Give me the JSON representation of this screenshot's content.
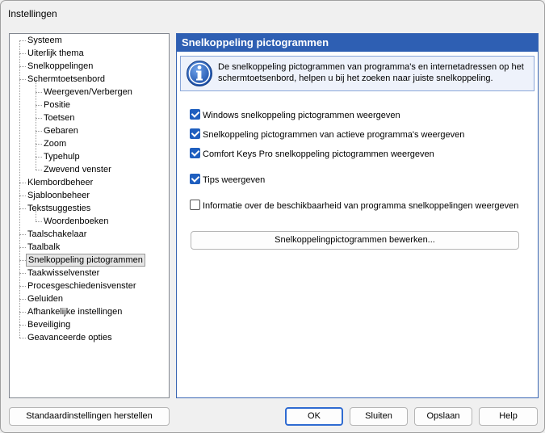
{
  "window": {
    "title": "Instellingen"
  },
  "tree": {
    "items": [
      {
        "label": "Systeem",
        "level": 0
      },
      {
        "label": "Uiterlijk thema",
        "level": 0
      },
      {
        "label": "Snelkoppelingen",
        "level": 0
      },
      {
        "label": "Schermtoetsenbord",
        "level": 0
      },
      {
        "label": "Weergeven/Verbergen",
        "level": 1
      },
      {
        "label": "Positie",
        "level": 1
      },
      {
        "label": "Toetsen",
        "level": 1
      },
      {
        "label": "Gebaren",
        "level": 1
      },
      {
        "label": "Zoom",
        "level": 1
      },
      {
        "label": "Typehulp",
        "level": 1
      },
      {
        "label": "Zwevend venster",
        "level": 1
      },
      {
        "label": "Klembordbeheer",
        "level": 0
      },
      {
        "label": "Sjabloonbeheer",
        "level": 0
      },
      {
        "label": "Tekstsuggesties",
        "level": 0
      },
      {
        "label": "Woordenboeken",
        "level": 1
      },
      {
        "label": "Taalschakelaar",
        "level": 0
      },
      {
        "label": "Taalbalk",
        "level": 0
      },
      {
        "label": "Snelkoppeling pictogrammen",
        "level": 0,
        "selected": true
      },
      {
        "label": "Taakwisselvenster",
        "level": 0
      },
      {
        "label": "Procesgeschiedenisvenster",
        "level": 0
      },
      {
        "label": "Geluiden",
        "level": 0
      },
      {
        "label": "Afhankelijke instellingen",
        "level": 0
      },
      {
        "label": "Beveiliging",
        "level": 0
      },
      {
        "label": "Geavanceerde opties",
        "level": 0
      }
    ]
  },
  "panel": {
    "header": "Snelkoppeling pictogrammen",
    "info_icon": "info-icon",
    "info_text": "De snelkoppeling pictogrammen van programma's en internetadressen op het schermtoetsenbord, helpen u bij het zoeken naar juiste snelkoppeling.",
    "checkboxes": [
      {
        "label": "Windows snelkoppeling pictogrammen weergeven",
        "checked": true
      },
      {
        "label": "Snelkoppeling pictogrammen van actieve programma's weergeven",
        "checked": true
      },
      {
        "label": "Comfort Keys Pro snelkoppeling pictogrammen weergeven",
        "checked": true
      },
      {
        "label": "Tips weergeven",
        "checked": true
      },
      {
        "label": "Informatie over de beschikbaarheid van programma snelkoppelingen weergeven",
        "checked": false
      }
    ],
    "edit_button": "Snelkoppelingpictogrammen bewerken..."
  },
  "footer": {
    "reset": "Standaardinstellingen herstellen",
    "ok": "OK",
    "close": "Sluiten",
    "save": "Opslaan",
    "help": "Help"
  },
  "colors": {
    "accent": "#2e5fb3",
    "checkbox": "#1f5fbf"
  }
}
